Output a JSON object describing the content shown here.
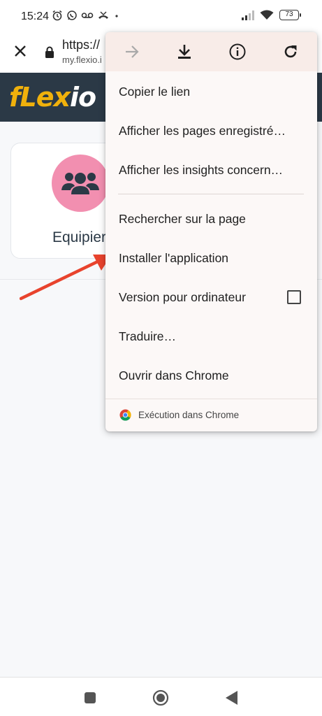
{
  "status_bar": {
    "time": "15:24",
    "battery": "73",
    "icons_left": [
      "alarm-icon",
      "whatsapp-icon",
      "voicemail-icon",
      "missed-call-icon",
      "dot-icon"
    ],
    "icons_right": [
      "signal-icon",
      "wifi-icon",
      "battery-icon"
    ]
  },
  "toolbar": {
    "url_main": "https://",
    "url_sub": "my.flexio.i",
    "close_icon": "close-icon",
    "lock_icon": "lock-icon"
  },
  "site": {
    "logo_part1": "fLex",
    "logo_part2": "io",
    "card_label": "Equipier",
    "card_icon": "users-icon",
    "header_color": "#2b3946",
    "avatar_color": "#f28fb0",
    "logo_color": "#f0b10c"
  },
  "menu": {
    "actions": [
      "forward-icon",
      "download-icon",
      "info-icon",
      "refresh-icon"
    ],
    "items": [
      {
        "label": "Copier le lien"
      },
      {
        "label": "Afficher les pages enregistré…"
      },
      {
        "label": "Afficher les insights concern…"
      },
      {
        "label": "Rechercher sur la page"
      },
      {
        "label": "Installer l'application"
      },
      {
        "label": "Version pour ordinateur"
      },
      {
        "label": "Traduire…"
      },
      {
        "label": "Ouvrir dans Chrome"
      }
    ],
    "desktop_checked": false,
    "footer": "Exécution dans Chrome",
    "background": "#fcf8f7",
    "actions_background": "#f8ece8"
  },
  "annotation": {
    "arrow_color": "#e8432d",
    "arrow_icon": "red-arrow-icon"
  },
  "nav_bar": {
    "buttons": [
      "recent-apps-icon",
      "home-icon",
      "back-icon"
    ]
  }
}
